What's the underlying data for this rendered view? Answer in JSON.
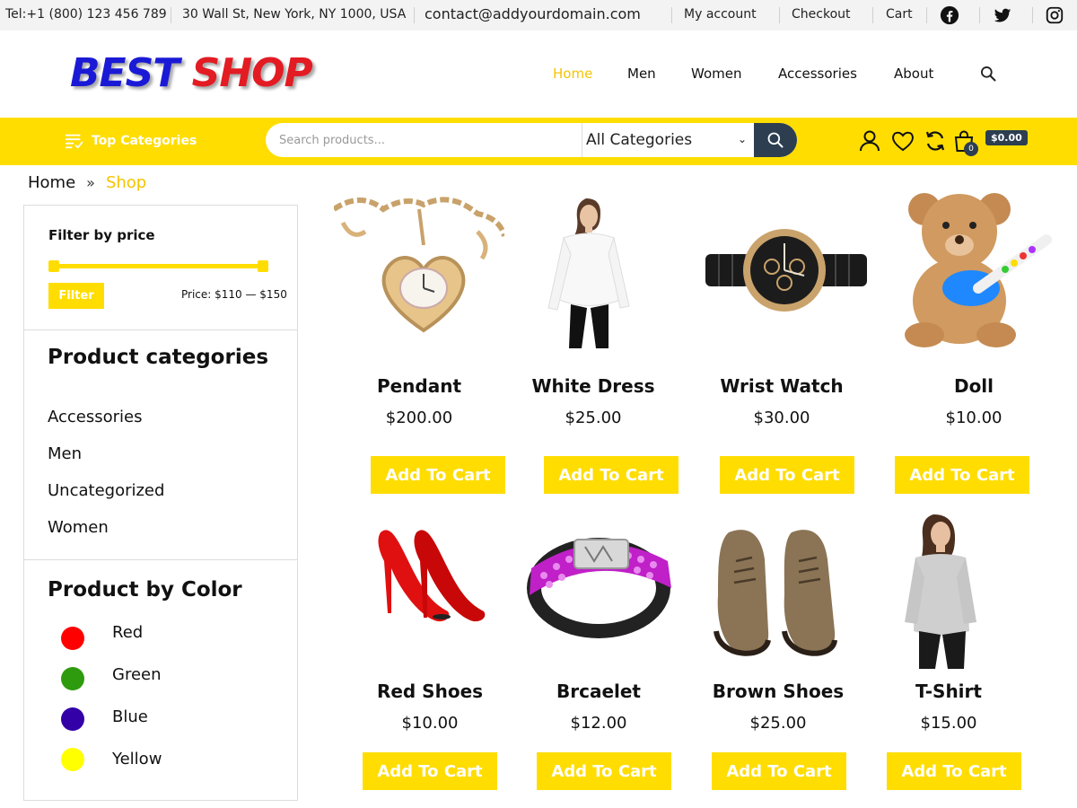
{
  "topbar": {
    "tel": "Tel:+1 (800) 123 456 789",
    "address": "30 Wall St, New York, NY 1000, USA",
    "email": "contact@addyourdomain.com",
    "links": [
      "My account",
      "Checkout",
      "Cart"
    ],
    "social_icons": [
      "facebook-icon",
      "twitter-icon",
      "instagram-icon"
    ]
  },
  "header": {
    "logo_part1": "BEST",
    "logo_part2": "SHOP",
    "nav": [
      "Home",
      "Men",
      "Women",
      "Accessories",
      "About"
    ],
    "active_nav": "Home"
  },
  "searchbar": {
    "top_categories": "Top Categories",
    "placeholder": "Search products...",
    "category_selected": "All Categories",
    "cart_count": "0",
    "cart_total": "$0.00"
  },
  "breadcrumb": {
    "home": "Home",
    "current": "Shop"
  },
  "sidebar": {
    "filter_title": "Filter by price",
    "filter_button": "Filter",
    "price_range": "Price: $110 — $150",
    "categories_title": "Product categories",
    "categories": [
      "Accessories",
      "Men",
      "Uncategorized",
      "Women"
    ],
    "color_title": "Product by Color",
    "colors": [
      {
        "label": "Red",
        "hex": "#ff0000"
      },
      {
        "label": "Green",
        "hex": "#2e9b0e"
      },
      {
        "label": "Blue",
        "hex": "#3300a8"
      },
      {
        "label": "Yellow",
        "hex": "#ffff00"
      }
    ]
  },
  "products": [
    {
      "name": "Pendant",
      "price": "$200.00",
      "button": "Add To Cart"
    },
    {
      "name": "White Dress",
      "price": "$25.00",
      "button": "Add To Cart"
    },
    {
      "name": "Wrist Watch",
      "price": "$30.00",
      "button": "Add To Cart"
    },
    {
      "name": "Doll",
      "price": "$10.00",
      "button": "Add To Cart"
    },
    {
      "name": "Red Shoes",
      "price": "$10.00",
      "button": "Add To Cart"
    },
    {
      "name": "Brcaelet",
      "price": "$12.00",
      "button": "Add To Cart"
    },
    {
      "name": "Brown Shoes",
      "price": "$25.00",
      "button": "Add To Cart"
    },
    {
      "name": "T-Shirt",
      "price": "$15.00",
      "button": "Add To Cart"
    }
  ],
  "colors": {
    "accent": "#ffdd00",
    "dark": "#2c3e50",
    "logo_blue": "#1a1ad6",
    "logo_red": "#e31b23"
  }
}
